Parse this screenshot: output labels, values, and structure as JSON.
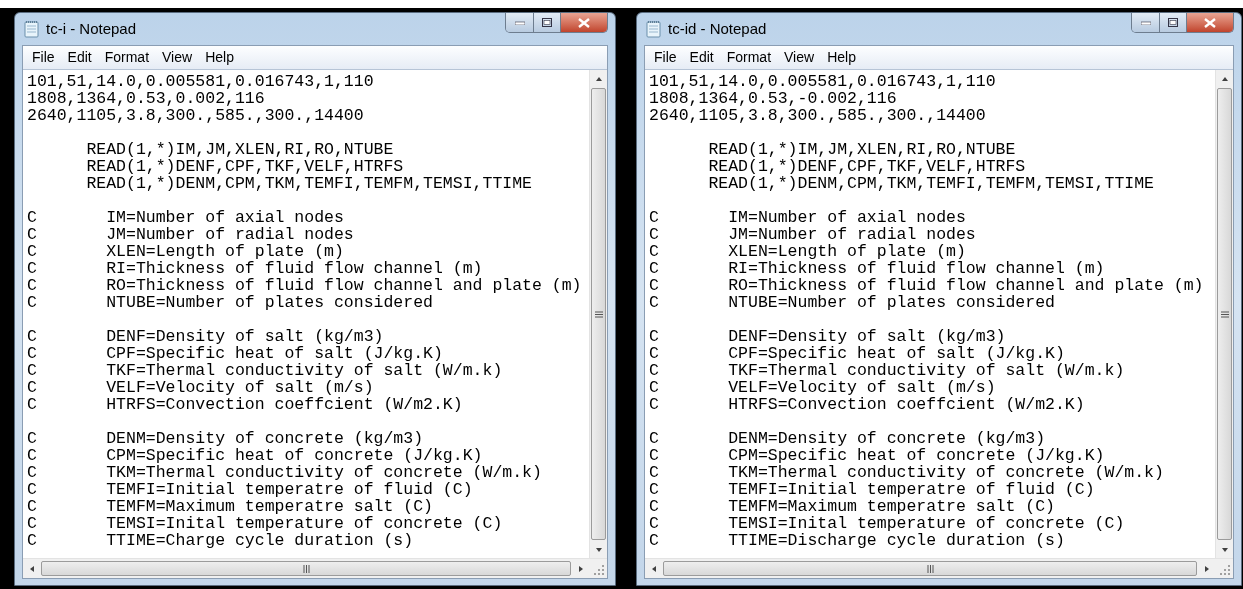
{
  "windows": [
    {
      "title": "tc-i - Notepad",
      "menu": [
        "File",
        "Edit",
        "Format",
        "View",
        "Help"
      ],
      "blocks": [
        [
          "101,51,14.0,0.005581,0.016743,1,110",
          "1808,1364,0.53,0.002,116",
          "2640,1105,3.8,300.,585.,300.,14400"
        ],
        [
          "      READ(1,*)IM,JM,XLEN,RI,RO,NTUBE",
          "      READ(1,*)DENF,CPF,TKF,VELF,HTRFS",
          "      READ(1,*)DENM,CPM,TKM,TEMFI,TEMFM,TEMSI,TTIME"
        ],
        [
          "C       IM=Number of axial nodes",
          "C       JM=Number of radial nodes",
          "C       XLEN=Length of plate (m)",
          "C       RI=Thickness of fluid flow channel (m)",
          "C       RO=Thickness of fluid flow channel and plate (m)",
          "C       NTUBE=Number of plates considered"
        ],
        [
          "C       DENF=Density of salt (kg/m3)",
          "C       CPF=Specific heat of salt (J/kg.K)",
          "C       TKF=Thermal conductivity of salt (W/m.k)",
          "C       VELF=Velocity of salt (m/s)",
          "C       HTRFS=Convection coeffcient (W/m2.K)"
        ],
        [
          "C       DENM=Density of concrete (kg/m3)",
          "C       CPM=Specific heat of concrete (J/kg.K)",
          "C       TKM=Thermal conductivity of concrete (W/m.k)",
          "C       TEMFI=Initial temperatre of fluid (C)",
          "C       TEMFM=Maximum temperatre salt (C)",
          "C       TEMSI=Inital temperature of concrete (C)",
          "C       TTIME=Charge cycle duration (s)"
        ]
      ]
    },
    {
      "title": "tc-id - Notepad",
      "menu": [
        "File",
        "Edit",
        "Format",
        "View",
        "Help"
      ],
      "blocks": [
        [
          "101,51,14.0,0.005581,0.016743,1,110",
          "1808,1364,0.53,-0.002,116",
          "2640,1105,3.8,300.,585.,300.,14400"
        ],
        [
          "      READ(1,*)IM,JM,XLEN,RI,RO,NTUBE",
          "      READ(1,*)DENF,CPF,TKF,VELF,HTRFS",
          "      READ(1,*)DENM,CPM,TKM,TEMFI,TEMFM,TEMSI,TTIME"
        ],
        [
          "C       IM=Number of axial nodes",
          "C       JM=Number of radial nodes",
          "C       XLEN=Length of plate (m)",
          "C       RI=Thickness of fluid flow channel (m)",
          "C       RO=Thickness of fluid flow channel and plate (m)",
          "C       NTUBE=Number of plates considered"
        ],
        [
          "C       DENF=Density of salt (kg/m3)",
          "C       CPF=Specific heat of salt (J/kg.K)",
          "C       TKF=Thermal conductivity of salt (W/m.k)",
          "C       VELF=Velocity of salt (m/s)",
          "C       HTRFS=Convection coeffcient (W/m2.K)"
        ],
        [
          "C       DENM=Density of concrete (kg/m3)",
          "C       CPM=Specific heat of concrete (J/kg.K)",
          "C       TKM=Thermal conductivity of concrete (W/m.k)",
          "C       TEMFI=Initial temperatre of fluid (C)",
          "C       TEMFM=Maximum temperatre salt (C)",
          "C       TEMSI=Inital temperature of concrete (C)",
          "C       TTIME=Discharge cycle duration (s)"
        ]
      ]
    }
  ]
}
